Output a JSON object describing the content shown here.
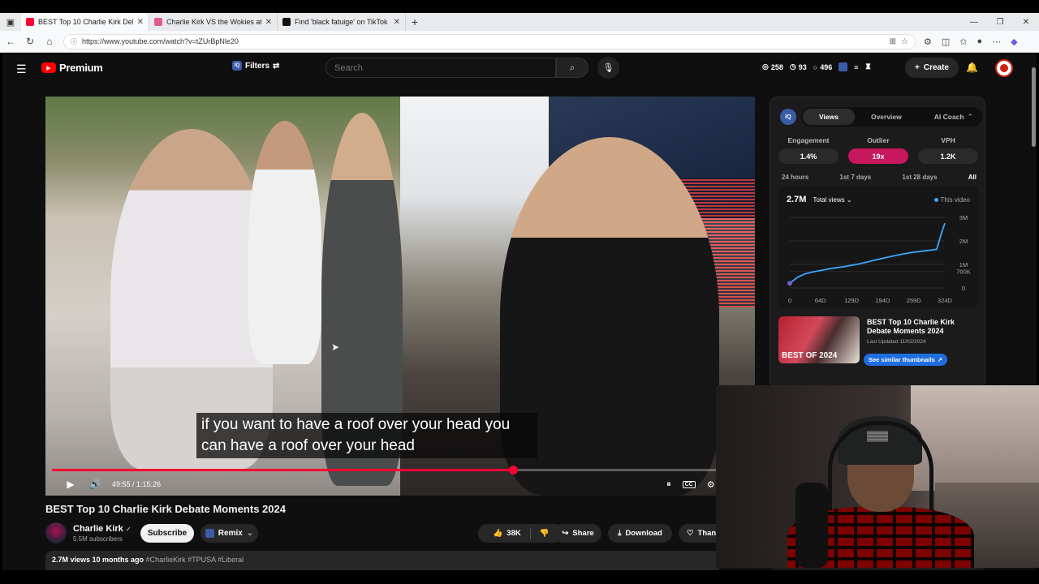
{
  "browser": {
    "tabs": [
      {
        "title": "BEST Top 10 Charlie Kirk Debate M",
        "favicon_color": "#ff0033",
        "active": true
      },
      {
        "title": "Charlie Kirk VS the Wokies at Unive",
        "favicon_color": "#e05a8a",
        "active": false
      },
      {
        "title": "Find 'black fatuige' on TikTok | Tik",
        "favicon_color": "#111111",
        "active": false
      }
    ],
    "url": "https://www.youtube.com/watch?v=tZUrBpNle20"
  },
  "youtube": {
    "logo_text": "Premium",
    "filters_label": "Filters",
    "search_placeholder": "Search",
    "stats": {
      "a": "258",
      "b": "93",
      "c": "496"
    },
    "create_label": "Create",
    "video": {
      "subtitle": "if you want to have a roof over your head you can have a roof over your head",
      "time_current": "49:55",
      "time_total": "1:15:26",
      "time_display": "49:55 / 1:15:26",
      "progress_fraction": 0.662,
      "title": "BEST Top 10 Charlie Kirk Debate Moments 2024"
    },
    "channel": {
      "name": "Charlie Kirk",
      "subscribers": "5.5M subscribers",
      "subscribe_label": "Subscribe",
      "remix_label": "Remix"
    },
    "actions": {
      "likes": "38K",
      "share": "Share",
      "download": "Download",
      "thanks": "Thanks"
    },
    "description": {
      "meta": "2.7M views  10 months ago",
      "tags": "#CharlieKirk #TPUSA #Liberal"
    }
  },
  "panel": {
    "tabs": [
      "Views",
      "Overview",
      "AI Coach"
    ],
    "iq_label": "IQ",
    "metrics": [
      {
        "label": "Engagement",
        "value": "1.4%"
      },
      {
        "label": "Outlier",
        "value": "19x"
      },
      {
        "label": "VPH",
        "value": "1.2K"
      }
    ],
    "ranges": [
      "24 hours",
      "1st 7 days",
      "1st 28 days",
      "All"
    ],
    "total": "2.7M",
    "total_dropdown": "Total views",
    "legend": "This video",
    "thumb": {
      "overlay_text": "BEST OF 2024",
      "title": "BEST Top 10 Charlie Kirk Debate Moments 2024",
      "last_updated": "Last Updated 11/02/2024",
      "similar_label": "See similar thumbnails"
    }
  },
  "chart_data": {
    "type": "line",
    "series": [
      {
        "name": "This video",
        "color": "#3ea6ff"
      }
    ],
    "x": [
      0,
      16,
      32,
      48,
      64,
      80,
      96,
      112,
      129,
      145,
      161,
      177,
      194,
      210,
      226,
      242,
      259,
      275,
      291,
      307,
      318,
      324
    ],
    "y": [
      0.2,
      0.45,
      0.6,
      0.68,
      0.74,
      0.8,
      0.86,
      0.9,
      0.96,
      1.02,
      1.1,
      1.18,
      1.26,
      1.33,
      1.4,
      1.46,
      1.52,
      1.56,
      1.6,
      1.64,
      2.4,
      2.75
    ],
    "x_ticks": [
      "0",
      "64D",
      "129D",
      "194D",
      "259D",
      "324D"
    ],
    "y_ticks": [
      "3M",
      "2M",
      "1M",
      "700K",
      "0"
    ],
    "xlim": [
      0,
      324
    ],
    "ylim": [
      0,
      3
    ],
    "grid": true
  }
}
